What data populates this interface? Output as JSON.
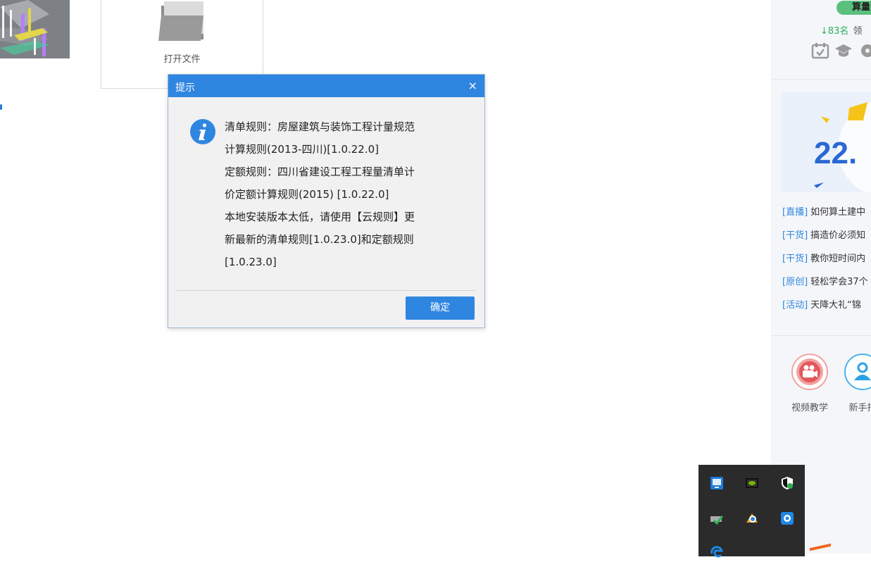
{
  "open_file": {
    "label": "打开文件",
    "icon": "folder-icon"
  },
  "dialog": {
    "title": "提示",
    "close_glyph": "×",
    "icon": "info-icon",
    "message_lines": [
      "清单规则：房屋建筑与装饰工程计量规范",
      "计算规则(2013-四川)[1.0.22.0]",
      "定额规则：四川省建设工程工程量清单计",
      "价定额计算规则(2015) [1.0.22.0]",
      "本地安装版本太低，请使用【云规则】更",
      "新最新的清单规则[1.0.23.0]和定额规则",
      "[1.0.23.0]"
    ],
    "ok_label": "确定",
    "accent_color": "#2f86e0"
  },
  "right_panel": {
    "badge": "算量",
    "rank": "↓83名",
    "rank_suffix": "领",
    "banner_text": "22.",
    "news": [
      {
        "tag": "[直播]",
        "text": "如何算土建中"
      },
      {
        "tag": "[干货]",
        "text": "搞造价必须知"
      },
      {
        "tag": "[干货]",
        "text": "教你短时间内"
      },
      {
        "tag": "[原创]",
        "text": "轻松学会37个"
      },
      {
        "tag": "[活动]",
        "text": "天降大礼“锦"
      }
    ],
    "tools": [
      {
        "label": "视频教学",
        "icon": "video-camera-icon"
      },
      {
        "label": "新手指",
        "icon": "user-guide-icon"
      }
    ]
  },
  "tray": {
    "icons": [
      "teamviewer-icon",
      "nvidia-icon",
      "security-shield-icon",
      "network-check-icon",
      "cloud-app-icon",
      "sync-app-icon",
      "browser-icon"
    ]
  }
}
